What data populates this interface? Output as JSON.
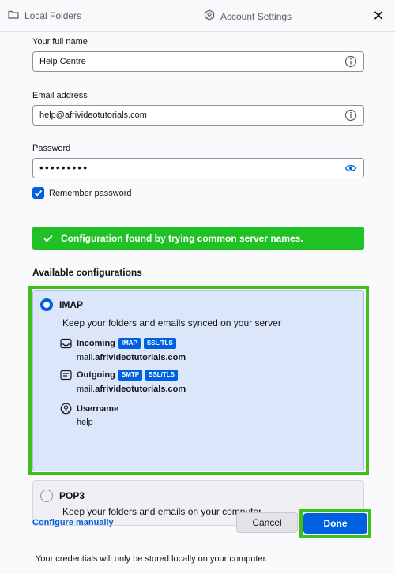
{
  "tabs": {
    "left_label": "Local Folders",
    "center_label": "Account Settings",
    "close_glyph": "✕"
  },
  "form": {
    "full_name_label": "Your full name",
    "full_name_value": "Help Centre",
    "email_label": "Email address",
    "email_value": "help@afrivideotutorials.com",
    "password_label": "Password",
    "password_value": "•••••••••",
    "remember_label": "Remember password",
    "remember_checked": true
  },
  "banner": {
    "text": "Configuration found by trying common server names."
  },
  "configs": {
    "title": "Available configurations",
    "imap": {
      "name": "IMAP",
      "description": "Keep your folders and emails synced on your server",
      "incoming_label": "Incoming",
      "incoming_tags": [
        "IMAP",
        "SSL/TLS"
      ],
      "incoming_host_prefix": "mail.",
      "incoming_host_domain": "afrivideotutorials.com",
      "outgoing_label": "Outgoing",
      "outgoing_tags": [
        "SMTP",
        "SSL/TLS"
      ],
      "outgoing_host_prefix": "mail.",
      "outgoing_host_domain": "afrivideotutorials.com",
      "username_label": "Username",
      "username_value": "help",
      "selected": true
    },
    "pop3": {
      "name": "POP3",
      "description": "Keep your folders and emails on your computer",
      "selected": false
    }
  },
  "actions": {
    "configure_manually": "Configure manually",
    "cancel": "Cancel",
    "done": "Done"
  },
  "footer": {
    "note": "Your credentials will only be stored locally on your computer."
  },
  "colors": {
    "accent": "#0061e0",
    "success": "#1fc124",
    "highlight_outline": "#3fbf1b"
  }
}
